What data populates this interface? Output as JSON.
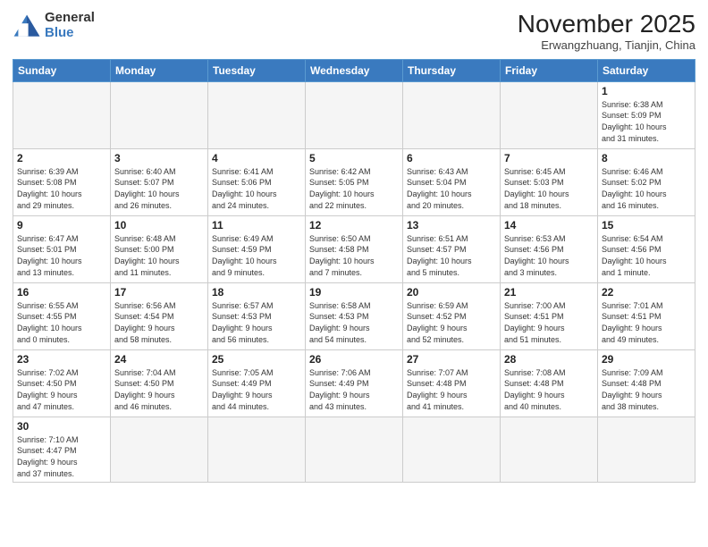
{
  "logo": {
    "line1": "General",
    "line2": "Blue"
  },
  "title": "November 2025",
  "location": "Erwangzhuang, Tianjin, China",
  "weekdays": [
    "Sunday",
    "Monday",
    "Tuesday",
    "Wednesday",
    "Thursday",
    "Friday",
    "Saturday"
  ],
  "days": [
    {
      "num": "",
      "info": ""
    },
    {
      "num": "",
      "info": ""
    },
    {
      "num": "",
      "info": ""
    },
    {
      "num": "",
      "info": ""
    },
    {
      "num": "",
      "info": ""
    },
    {
      "num": "",
      "info": ""
    },
    {
      "num": "1",
      "info": "Sunrise: 6:38 AM\nSunset: 5:09 PM\nDaylight: 10 hours\nand 31 minutes."
    },
    {
      "num": "2",
      "info": "Sunrise: 6:39 AM\nSunset: 5:08 PM\nDaylight: 10 hours\nand 29 minutes."
    },
    {
      "num": "3",
      "info": "Sunrise: 6:40 AM\nSunset: 5:07 PM\nDaylight: 10 hours\nand 26 minutes."
    },
    {
      "num": "4",
      "info": "Sunrise: 6:41 AM\nSunset: 5:06 PM\nDaylight: 10 hours\nand 24 minutes."
    },
    {
      "num": "5",
      "info": "Sunrise: 6:42 AM\nSunset: 5:05 PM\nDaylight: 10 hours\nand 22 minutes."
    },
    {
      "num": "6",
      "info": "Sunrise: 6:43 AM\nSunset: 5:04 PM\nDaylight: 10 hours\nand 20 minutes."
    },
    {
      "num": "7",
      "info": "Sunrise: 6:45 AM\nSunset: 5:03 PM\nDaylight: 10 hours\nand 18 minutes."
    },
    {
      "num": "8",
      "info": "Sunrise: 6:46 AM\nSunset: 5:02 PM\nDaylight: 10 hours\nand 16 minutes."
    },
    {
      "num": "9",
      "info": "Sunrise: 6:47 AM\nSunset: 5:01 PM\nDaylight: 10 hours\nand 13 minutes."
    },
    {
      "num": "10",
      "info": "Sunrise: 6:48 AM\nSunset: 5:00 PM\nDaylight: 10 hours\nand 11 minutes."
    },
    {
      "num": "11",
      "info": "Sunrise: 6:49 AM\nSunset: 4:59 PM\nDaylight: 10 hours\nand 9 minutes."
    },
    {
      "num": "12",
      "info": "Sunrise: 6:50 AM\nSunset: 4:58 PM\nDaylight: 10 hours\nand 7 minutes."
    },
    {
      "num": "13",
      "info": "Sunrise: 6:51 AM\nSunset: 4:57 PM\nDaylight: 10 hours\nand 5 minutes."
    },
    {
      "num": "14",
      "info": "Sunrise: 6:53 AM\nSunset: 4:56 PM\nDaylight: 10 hours\nand 3 minutes."
    },
    {
      "num": "15",
      "info": "Sunrise: 6:54 AM\nSunset: 4:56 PM\nDaylight: 10 hours\nand 1 minute."
    },
    {
      "num": "16",
      "info": "Sunrise: 6:55 AM\nSunset: 4:55 PM\nDaylight: 10 hours\nand 0 minutes."
    },
    {
      "num": "17",
      "info": "Sunrise: 6:56 AM\nSunset: 4:54 PM\nDaylight: 9 hours\nand 58 minutes."
    },
    {
      "num": "18",
      "info": "Sunrise: 6:57 AM\nSunset: 4:53 PM\nDaylight: 9 hours\nand 56 minutes."
    },
    {
      "num": "19",
      "info": "Sunrise: 6:58 AM\nSunset: 4:53 PM\nDaylight: 9 hours\nand 54 minutes."
    },
    {
      "num": "20",
      "info": "Sunrise: 6:59 AM\nSunset: 4:52 PM\nDaylight: 9 hours\nand 52 minutes."
    },
    {
      "num": "21",
      "info": "Sunrise: 7:00 AM\nSunset: 4:51 PM\nDaylight: 9 hours\nand 51 minutes."
    },
    {
      "num": "22",
      "info": "Sunrise: 7:01 AM\nSunset: 4:51 PM\nDaylight: 9 hours\nand 49 minutes."
    },
    {
      "num": "23",
      "info": "Sunrise: 7:02 AM\nSunset: 4:50 PM\nDaylight: 9 hours\nand 47 minutes."
    },
    {
      "num": "24",
      "info": "Sunrise: 7:04 AM\nSunset: 4:50 PM\nDaylight: 9 hours\nand 46 minutes."
    },
    {
      "num": "25",
      "info": "Sunrise: 7:05 AM\nSunset: 4:49 PM\nDaylight: 9 hours\nand 44 minutes."
    },
    {
      "num": "26",
      "info": "Sunrise: 7:06 AM\nSunset: 4:49 PM\nDaylight: 9 hours\nand 43 minutes."
    },
    {
      "num": "27",
      "info": "Sunrise: 7:07 AM\nSunset: 4:48 PM\nDaylight: 9 hours\nand 41 minutes."
    },
    {
      "num": "28",
      "info": "Sunrise: 7:08 AM\nSunset: 4:48 PM\nDaylight: 9 hours\nand 40 minutes."
    },
    {
      "num": "29",
      "info": "Sunrise: 7:09 AM\nSunset: 4:48 PM\nDaylight: 9 hours\nand 38 minutes."
    },
    {
      "num": "30",
      "info": "Sunrise: 7:10 AM\nSunset: 4:47 PM\nDaylight: 9 hours\nand 37 minutes."
    },
    {
      "num": "",
      "info": ""
    },
    {
      "num": "",
      "info": ""
    },
    {
      "num": "",
      "info": ""
    },
    {
      "num": "",
      "info": ""
    },
    {
      "num": "",
      "info": ""
    },
    {
      "num": "",
      "info": ""
    }
  ]
}
